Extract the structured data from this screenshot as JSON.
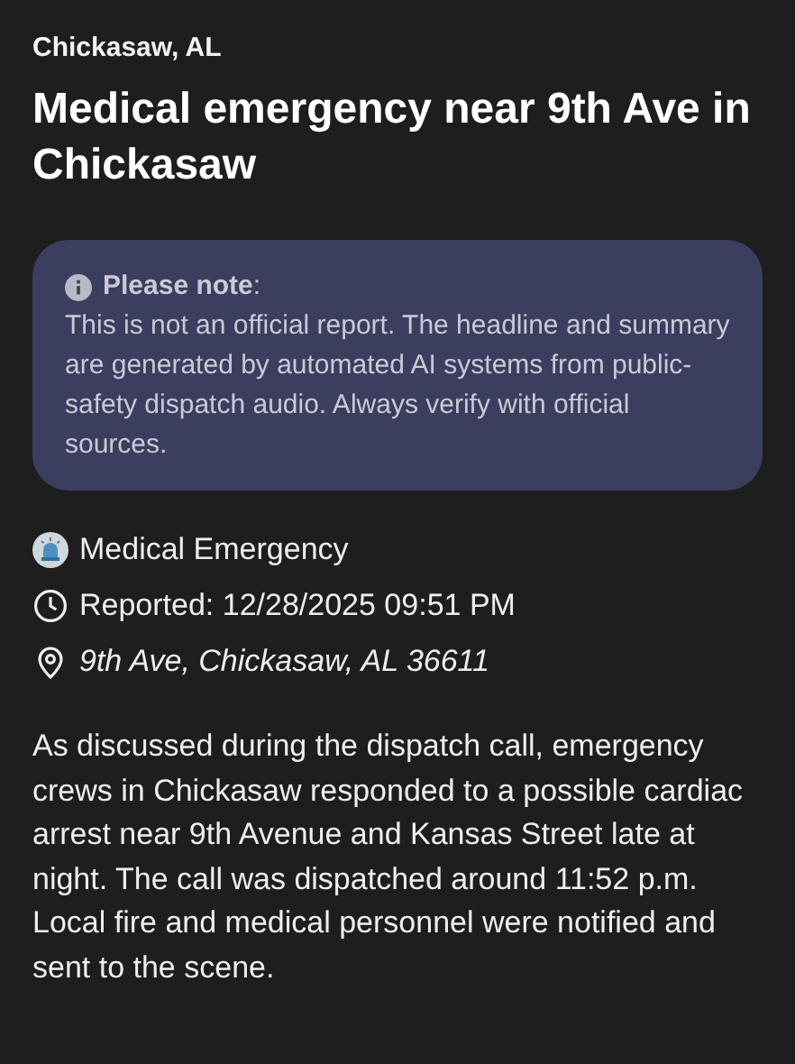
{
  "location_label": "Chickasaw, AL",
  "headline": "Medical emergency near 9th Ave in Chickasaw",
  "notice": {
    "heading": "**Please note**:",
    "body": "This is not an official report. The headline and summary are generated by automated AI systems from public-safety dispatch audio. Always verify with official sources."
  },
  "details": [
    {
      "kind": "category",
      "text": "Medical Emergency"
    },
    {
      "kind": "time",
      "text": "Reported: 12/28/2025 09:51 PM"
    },
    {
      "kind": "address",
      "text": "9th Ave, Chickasaw, AL 36611"
    }
  ],
  "summary": "As discussed during the dispatch call, emergency crews in Chickasaw responded to a possible cardiac arrest near 9th Avenue and Kansas Street late at night. The call was dispatched around 11:52 p.m. Local fire and medical personnel were notified and sent to the scene."
}
